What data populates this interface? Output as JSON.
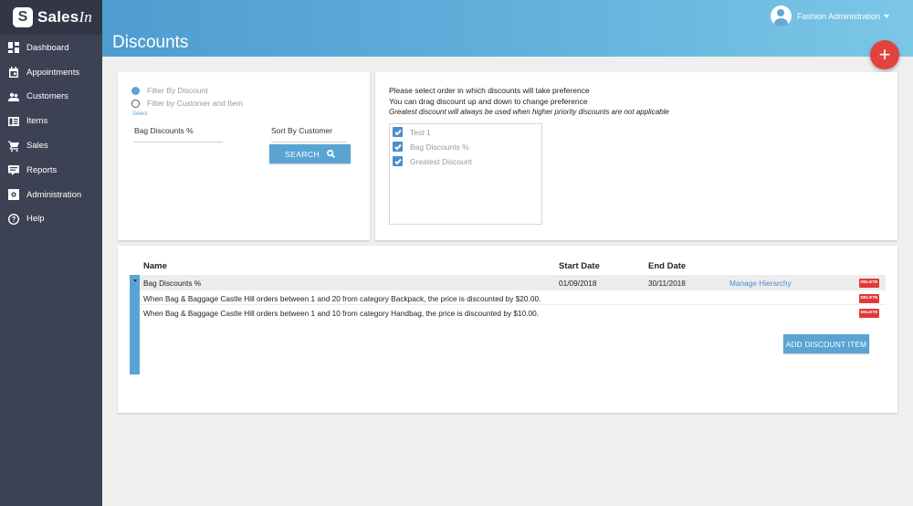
{
  "brand": {
    "logo_letter": "S",
    "name_bold": "Sales",
    "name_italic": "In"
  },
  "sidebar": {
    "items": [
      {
        "label": "Dashboard",
        "icon": "dashboard-icon"
      },
      {
        "label": "Appointments",
        "icon": "calendar-icon"
      },
      {
        "label": "Customers",
        "icon": "people-icon"
      },
      {
        "label": "Items",
        "icon": "items-list-icon"
      },
      {
        "label": "Sales",
        "icon": "cart-icon"
      },
      {
        "label": "Reports",
        "icon": "report-icon"
      },
      {
        "label": "Administration",
        "icon": "admin-icon"
      },
      {
        "label": "Help",
        "icon": "help-icon"
      }
    ]
  },
  "header": {
    "title": "Discounts",
    "user_name": "Fashion Administration",
    "fab_label": "+"
  },
  "filter": {
    "radio1_label": "Filter By Discount",
    "radio1_selected": true,
    "radio2_label": "Filter by Customer and Item",
    "select_caption": "Select",
    "select_value": "Bag Discounts %",
    "sort_value": "Sort By Customer",
    "search_label": "SEARCH"
  },
  "preference": {
    "line1": "Please select order in which discounts will take preference",
    "line2": "You can drag discount up and down to change preference",
    "note": "Greatest discount will always be used when higher priority discounts are not applicable",
    "items": [
      {
        "label": "Test 1",
        "checked": true
      },
      {
        "label": "Bag Discounts %",
        "checked": true
      },
      {
        "label": "Greatest Discount",
        "checked": true
      }
    ]
  },
  "table": {
    "headers": {
      "name": "Name",
      "start": "Start Date",
      "end": "End Date"
    },
    "parent": {
      "name": "Bag Discounts %",
      "start": "01/09/2018",
      "end": "30/11/2018",
      "link": "Manage Hierarchy",
      "delete": "DELETE"
    },
    "children": [
      {
        "text": "When Bag & Baggage Castle Hill orders between 1 and 20 from category Backpack, the price is discounted by $20.00.",
        "delete": "DELETE"
      },
      {
        "text": "When Bag & Baggage Castle Hill orders between 1 and 10 from category Handbag, the price is discounted by $10.00.",
        "delete": "DELETE"
      }
    ],
    "add_label": "ADD DISCOUNT ITEM"
  },
  "colors": {
    "sidebar": "#3c4253",
    "accent": "#5aa4d4",
    "danger": "#e03a36",
    "header_start": "#4f9cd0",
    "header_end": "#7cc7e6"
  }
}
